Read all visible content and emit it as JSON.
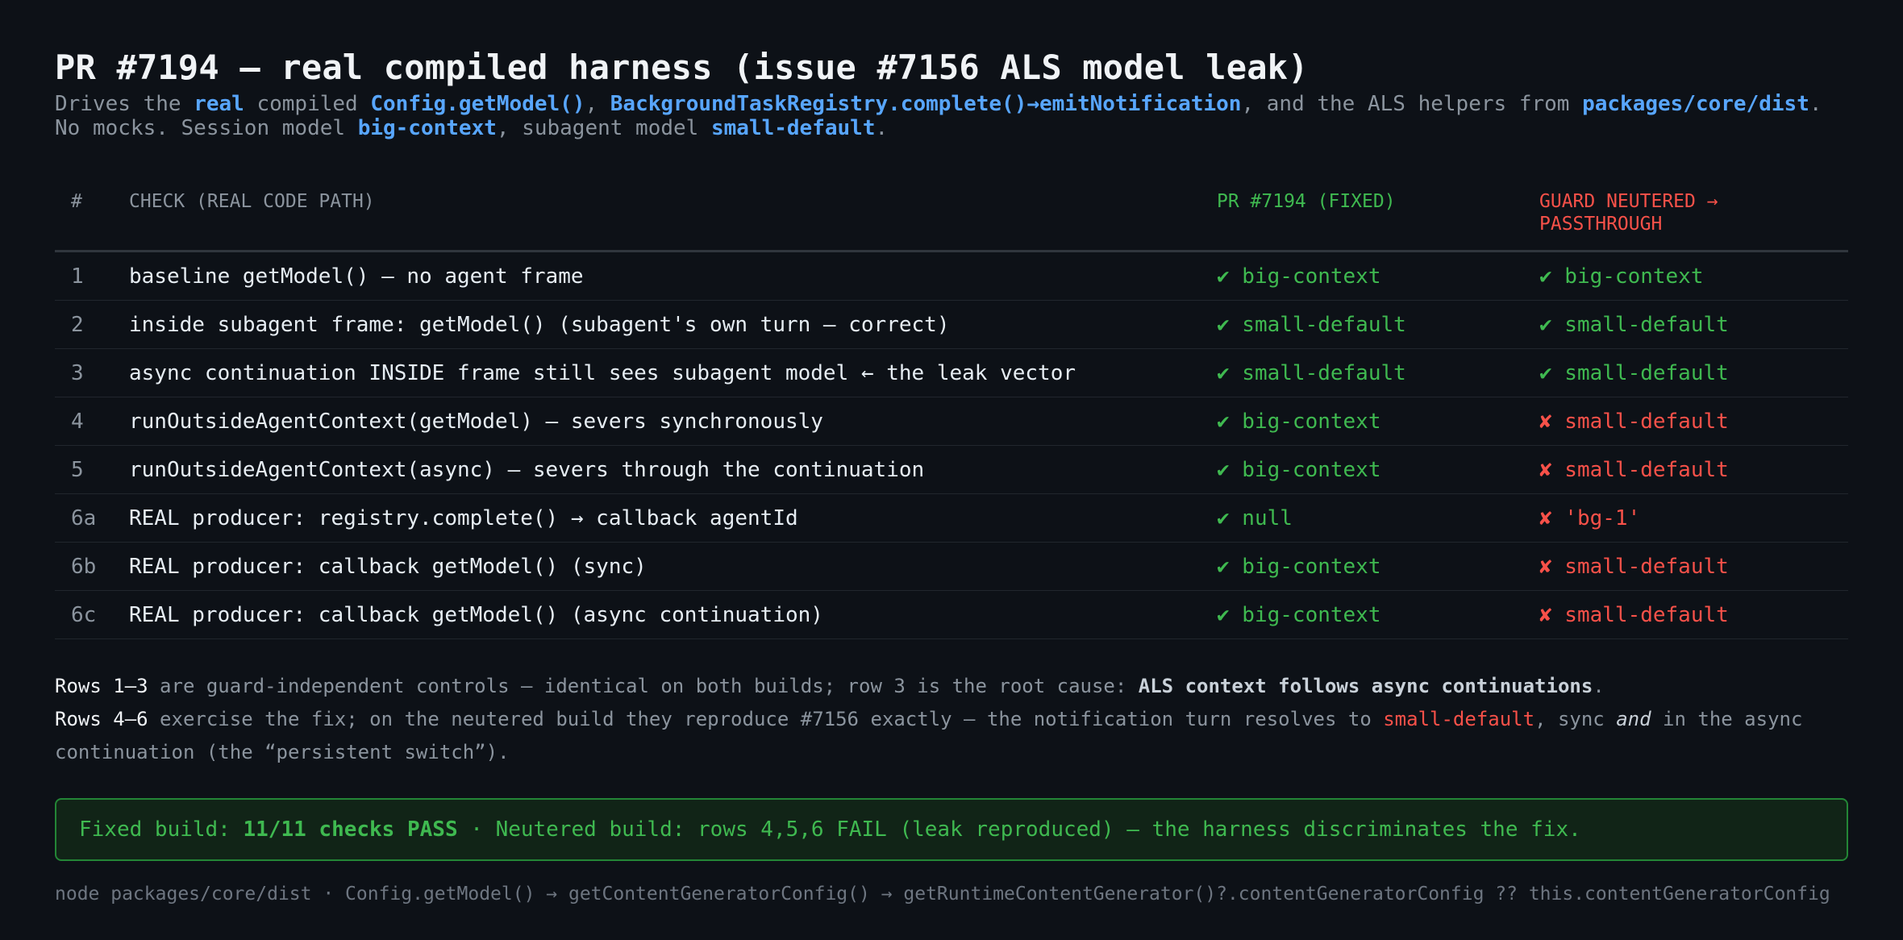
{
  "header": {
    "title": "PR #7194 — real compiled harness (issue #7156 ALS model leak)",
    "sub1_a": "Drives the ",
    "sub1_b": "real",
    "sub1_c": " compiled ",
    "sub1_d": "Config.getModel()",
    "sub1_e": ", ",
    "sub1_f": "BackgroundTaskRegistry.complete()→emitNotification",
    "sub1_g": ", and the ALS helpers from ",
    "sub1_h": "packages/core/dist",
    "sub1_i": ".",
    "sub2_a": "No mocks. Session model ",
    "sub2_b": "big-context",
    "sub2_c": ", subagent model ",
    "sub2_d": "small-default",
    "sub2_e": "."
  },
  "table": {
    "columns": {
      "num": "#",
      "check": "CHECK (REAL CODE PATH)",
      "fixed": "PR #7194 (FIXED)",
      "neutered": "GUARD NEUTERED → PASSTHROUGH"
    },
    "rows": [
      {
        "num": "1",
        "check": "baseline getModel() — no agent frame",
        "fixed": "✔ big-context",
        "neutered": "✔ big-context"
      },
      {
        "num": "2",
        "check": "inside subagent frame: getModel() (subagent's own turn — correct)",
        "fixed": "✔ small-default",
        "neutered": "✔ small-default"
      },
      {
        "num": "3",
        "check": "async continuation INSIDE frame still sees subagent model ← the leak vector",
        "fixed": "✔ small-default",
        "neutered": "✔ small-default"
      },
      {
        "num": "4",
        "check": "runOutsideAgentContext(getModel) — severs synchronously",
        "fixed": "✔ big-context",
        "neutered": "✘ small-default"
      },
      {
        "num": "5",
        "check": "runOutsideAgentContext(async) — severs through the continuation",
        "fixed": "✔ big-context",
        "neutered": "✘ small-default"
      },
      {
        "num": "6a",
        "check": "REAL producer: registry.complete() → callback agentId",
        "fixed": "✔ null",
        "neutered": "✘ 'bg-1'"
      },
      {
        "num": "6b",
        "check": "REAL producer: callback getModel() (sync)",
        "fixed": "✔ big-context",
        "neutered": "✘ small-default"
      },
      {
        "num": "6c",
        "check": "REAL producer: callback getModel() (async continuation)",
        "fixed": "✔ big-context",
        "neutered": "✘ small-default"
      }
    ]
  },
  "notes": {
    "n1_lead": "Rows 1–3",
    "n1_text": " are guard-independent controls — identical on both builds; row 3 is the root cause: ",
    "n1_strong": "ALS context follows async continuations",
    "n1_end": ".",
    "n2_lead": "Rows 4–6",
    "n2_text": " exercise the fix; on the neutered build they reproduce #7156 exactly — the notification turn resolves to ",
    "n2_red": "small-default",
    "n2_mid": ", sync ",
    "n2_em": "and",
    "n2_text2": " in the async",
    "n2_line2": "continuation (the “persistent switch”)."
  },
  "banner": {
    "a": "Fixed build: ",
    "b": "11/11 checks PASS",
    "c": "  ·  Neutered build: rows 4,5,6 FAIL (leak reproduced) — the harness discriminates the fix."
  },
  "footer": {
    "text": "node packages/core/dist · Config.getModel() → getContentGeneratorConfig() → getRuntimeContentGenerator()?.contentGeneratorConfig ?? this.contentGeneratorConfig"
  },
  "colors": {
    "background": "#0d1117",
    "accent_blue": "#58a6ff",
    "pass_green": "#3fb950",
    "fail_red": "#f85149"
  }
}
